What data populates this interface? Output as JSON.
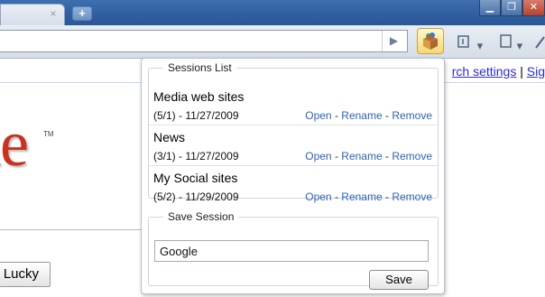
{
  "browser": {
    "tab_close": "×",
    "new_tab": "+",
    "window_controls": [
      "▁",
      "❐",
      "✕"
    ],
    "go": "▶",
    "page_menu": "▾",
    "tools_menu": "▾"
  },
  "page": {
    "top_links": {
      "settings": "rch settings",
      "separator": " | ",
      "sign": "Sig"
    },
    "logo_fragment": "le",
    "logo_tm": "TM",
    "lucky_button": "Lucky"
  },
  "popup": {
    "sessions_legend": "Sessions List",
    "sessions": [
      {
        "name": "Media web sites",
        "dates": "(5/1) - 11/27/2009",
        "open": "Open",
        "rename": "Rename",
        "remove": "Remove"
      },
      {
        "name": "News",
        "dates": "(3/1) - 11/27/2009",
        "open": "Open",
        "rename": "Rename",
        "remove": "Remove"
      },
      {
        "name": "My Social sites",
        "dates": "(5/2) - 11/29/2009",
        "open": "Open",
        "rename": "Rename",
        "remove": "Remove"
      }
    ],
    "separator": " - ",
    "save_legend": "Save Session",
    "save_value": "Google",
    "save_button": "Save"
  },
  "colors": {
    "link": "#2f63b5",
    "logo": "#c8321f",
    "titlebar": "#2f5d9e"
  }
}
